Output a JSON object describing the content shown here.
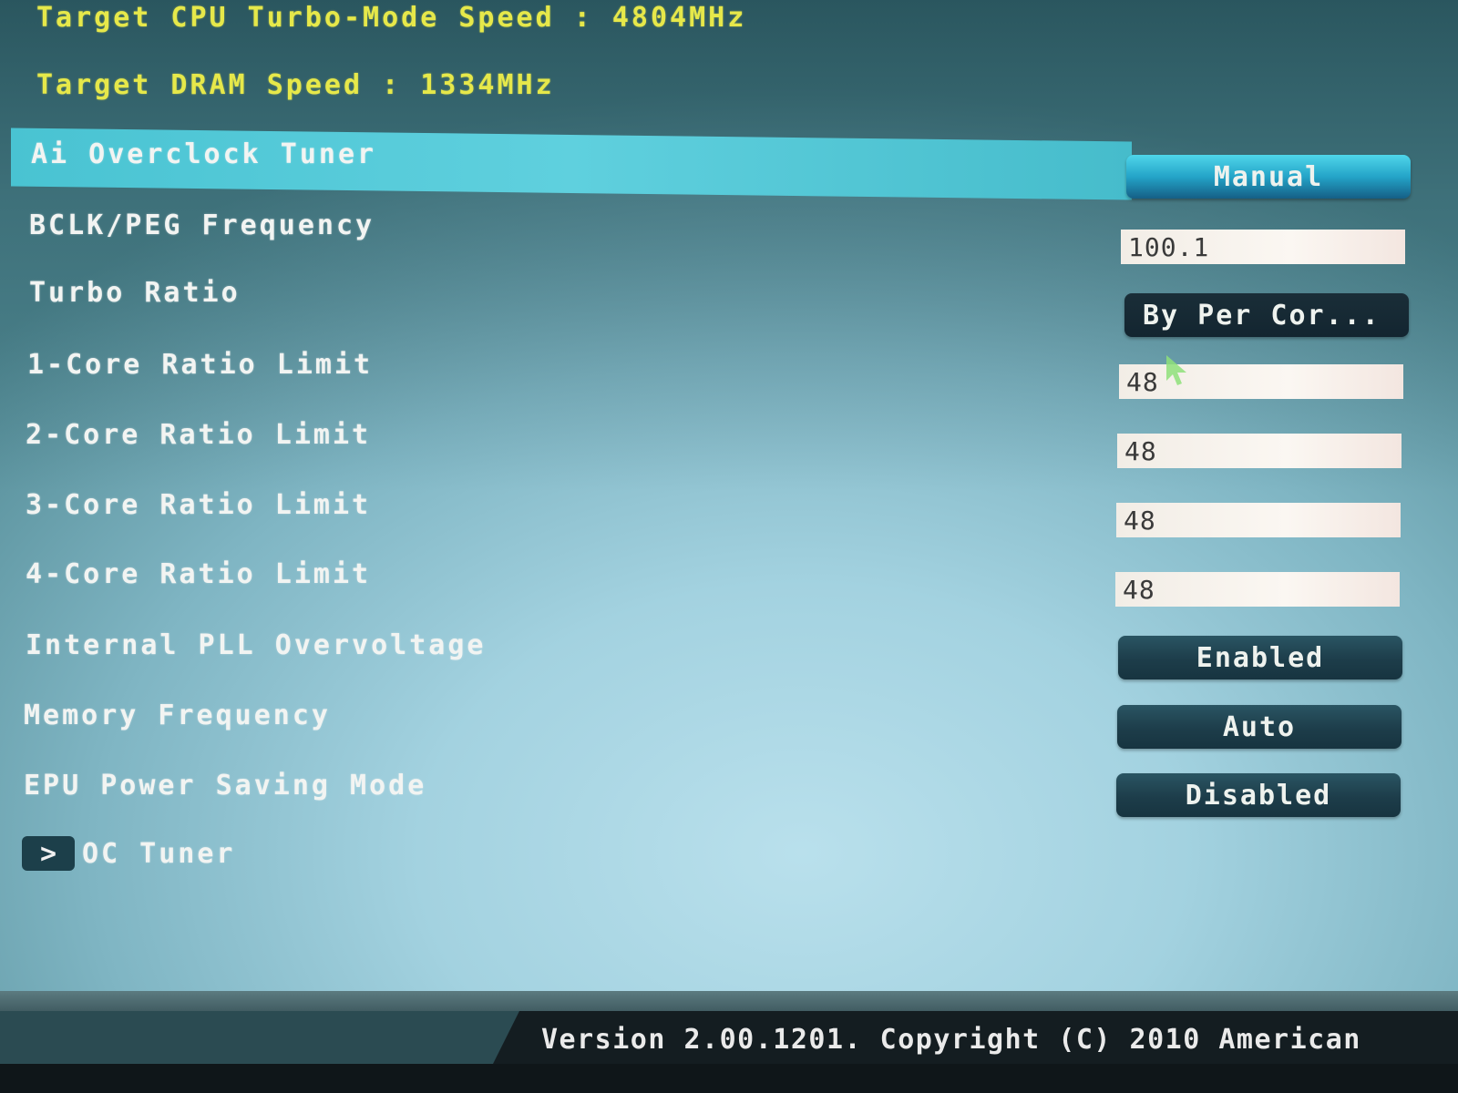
{
  "header": {
    "cpu_turbo_label": "Target CPU Turbo-Mode Speed : 4804MHz",
    "dram_label": "Target DRAM Speed : 1334MHz"
  },
  "settings": [
    {
      "label": "Ai Overclock Tuner",
      "type": "dropdown",
      "value": "Manual",
      "selected": true
    },
    {
      "label": "BCLK/PEG Frequency",
      "type": "input",
      "value": "100.1"
    },
    {
      "label": "Turbo Ratio",
      "type": "dropdown",
      "value": "By Per Cor..."
    },
    {
      "label": "1-Core Ratio Limit",
      "type": "input",
      "value": "48"
    },
    {
      "label": "2-Core Ratio Limit",
      "type": "input",
      "value": "48"
    },
    {
      "label": "3-Core Ratio Limit",
      "type": "input",
      "value": "48"
    },
    {
      "label": "4-Core Ratio Limit",
      "type": "input",
      "value": "48"
    },
    {
      "label": "Internal PLL Overvoltage",
      "type": "dropdown",
      "value": "Enabled"
    },
    {
      "label": "Memory Frequency",
      "type": "dropdown",
      "value": "Auto"
    },
    {
      "label": "EPU Power Saving Mode",
      "type": "dropdown",
      "value": "Disabled"
    }
  ],
  "submenu": {
    "arrow": ">",
    "label": "OC Tuner"
  },
  "footer": {
    "text": "Version 2.00.1201. Copyright (C) 2010 American"
  },
  "colors": {
    "accent_yellow": "#e6e84a",
    "highlight": "#5fd0de",
    "button_dark": "#1d3d4a"
  }
}
